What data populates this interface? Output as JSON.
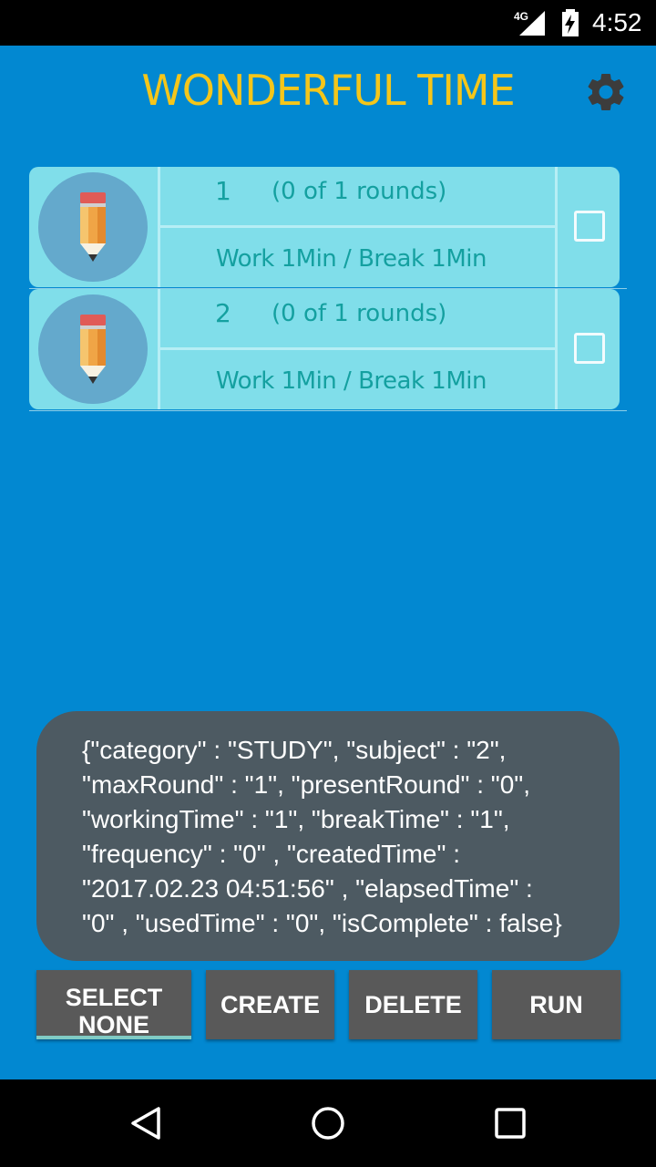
{
  "status_bar": {
    "network": "4G",
    "time": "4:52",
    "icons": [
      "signal-icon",
      "battery-charging-icon"
    ]
  },
  "app_bar": {
    "title": "WONDERFUL TIME",
    "settings_icon": "gear-icon",
    "title_color": "#f5c61a"
  },
  "tasks": [
    {
      "subject": "1",
      "rounds": "(0 of 1 rounds)",
      "timing": "Work 1Min / Break 1Min",
      "checked": false,
      "icon": "pencil-icon"
    },
    {
      "subject": "2",
      "rounds": "(0 of 1 rounds)",
      "timing": "Work 1Min / Break 1Min",
      "checked": false,
      "icon": "pencil-icon"
    }
  ],
  "toast": {
    "text": "{\"category\" : \"STUDY\", \"subject\" : \"2\",\n\"maxRound\" : \"1\", \"presentRound\" : \"0\",\n\"workingTime\" : \"1\", \"breakTime\" : \"1\",\n\"frequency\" : \"0\" , \"createdTime\" :\n\"2017.02.23 04:51:56\" , \"elapsedTime\" :\n\"0\" , \"usedTime\" : \"0\", \"isComplete\" : false}"
  },
  "buttons": {
    "select_none_line1": "SELECT",
    "select_none_line2": "NONE",
    "create": "CREATE",
    "delete": "DELETE",
    "run": "RUN"
  },
  "nav_bar": {
    "icons": [
      "back-icon",
      "home-icon",
      "recents-icon"
    ]
  },
  "colors": {
    "background": "#0288d1",
    "row": "#80deea",
    "row_text": "#14a0a0",
    "toast": "#4d5a62",
    "button": "#595959"
  }
}
